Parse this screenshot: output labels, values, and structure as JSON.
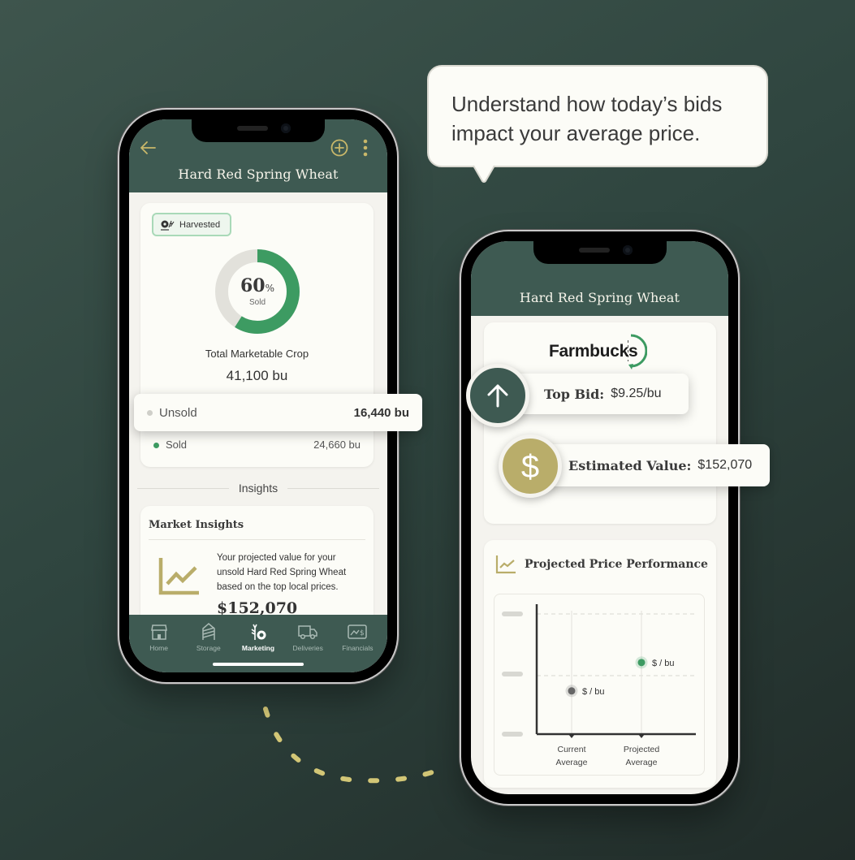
{
  "bubble": {
    "line1": "Understand how today’s bids",
    "line2": "impact your average price."
  },
  "phone1": {
    "header": {
      "title": "Hard Red Spring Wheat",
      "back_icon": "arrow-left-icon",
      "add_icon": "plus-circle-icon",
      "more_icon": "more-vertical-icon"
    },
    "crop_card": {
      "badge": {
        "icon": "harvester-icon",
        "label": "Harvested"
      },
      "donut": {
        "sold_percent": 60,
        "percent_text": "60",
        "percent_sign": "%",
        "label": "Sold"
      },
      "title": "Total Marketable Crop",
      "total": "41,100 bu",
      "rows": [
        {
          "label": "Unsold",
          "value": "16,440 bu",
          "color": "#cfcfc9"
        },
        {
          "label": "Sold",
          "value": "24,660 bu",
          "color": "#3d9b62"
        }
      ]
    },
    "insights_heading": "Insights",
    "market_insights": {
      "title": "Market Insights",
      "icon": "line-chart-icon",
      "text": "Your projected value for your unsold Hard Red Spring Wheat based on the top local prices.",
      "value": "$152,070"
    },
    "tabs": [
      {
        "label": "Home",
        "icon": "home-icon",
        "active": false
      },
      {
        "label": "Storage",
        "icon": "silo-icon",
        "active": false
      },
      {
        "label": "Marketing",
        "icon": "wheat-coin-icon",
        "active": true
      },
      {
        "label": "Deliveries",
        "icon": "truck-icon",
        "active": false
      },
      {
        "label": "Financials",
        "icon": "chart-dollar-icon",
        "active": false
      }
    ]
  },
  "phone2": {
    "header": {
      "title": "Hard Red Spring Wheat"
    },
    "brand": {
      "name": "Farmbucks"
    },
    "top_bid": {
      "label": "Top Bid:",
      "value": "$9.25/bu",
      "icon": "arrow-up-icon"
    },
    "estimated_value": {
      "label": "Estimated Value:",
      "value": "$152,070",
      "icon": "dollar-icon"
    },
    "projected_card": {
      "title": "Projected Price Performance",
      "icon": "line-chart-icon"
    }
  },
  "chart_data": {
    "type": "scatter",
    "title": "Projected Price Performance",
    "xlabel": "",
    "ylabel": "",
    "categories": [
      "Current Average",
      "Projected Average"
    ],
    "series": [
      {
        "name": "Current Average",
        "values": [
          0.35
        ],
        "label": "$ / bu",
        "color": "#666666"
      },
      {
        "name": "Projected Average",
        "values": [
          0.58
        ],
        "label": "$ / bu",
        "color": "#3d9b62"
      }
    ],
    "ylim": [
      0,
      1
    ],
    "y_ticks_placeholder_count": 3,
    "grid": "dashed-horizontal",
    "legend": "none"
  },
  "colors": {
    "brand_green": "#3e5a52",
    "accent_gold": "#b9ad6a",
    "success_green": "#3d9b62",
    "card_bg": "#fcfcf7"
  }
}
